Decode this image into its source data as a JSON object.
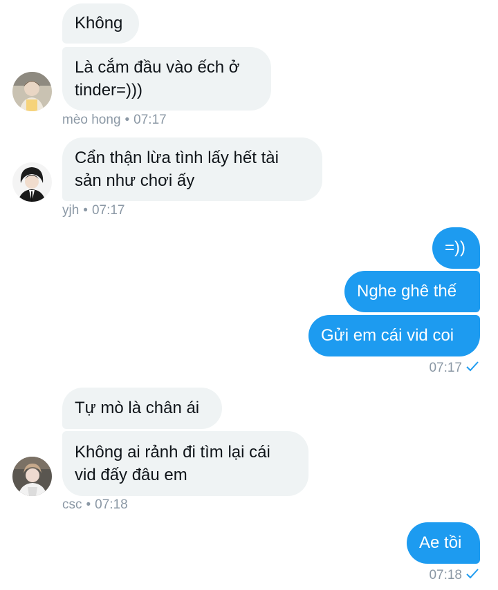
{
  "messages": [
    {
      "id": "m1",
      "text": "Không"
    },
    {
      "id": "m2",
      "lines": [
        "Là cắm đầu vào ếch ở",
        "tinder=)))"
      ]
    },
    {
      "id": "m3",
      "lines": [
        "Cẩn thận lừa tình lấy hết tài",
        "sản như chơi ấy"
      ]
    },
    {
      "id": "m4",
      "text": "=))"
    },
    {
      "id": "m5",
      "text": "Nghe ghê thế"
    },
    {
      "id": "m6",
      "text": "Gửi em cái vid coi"
    },
    {
      "id": "m7",
      "text": "Tự mò là chân ái"
    },
    {
      "id": "m8",
      "lines": [
        "Không ai rảnh đi tìm lại cái",
        "vid đấy đâu em"
      ]
    },
    {
      "id": "m9",
      "text": "Ae tồi"
    }
  ],
  "meta": {
    "g1": {
      "sender": "mèo hong",
      "time": "07:17"
    },
    "g2": {
      "sender": "yjh",
      "time": "07:17"
    },
    "g3": {
      "time": "07:17"
    },
    "g4": {
      "sender": "csc",
      "time": "07:18"
    },
    "g5": {
      "time": "07:18"
    }
  },
  "separator": "•",
  "icons": {
    "read_receipt": "check-icon"
  },
  "colors": {
    "outgoing": "#1d9bf0",
    "incoming": "#eff3f4",
    "meta": "#8b98a5"
  }
}
